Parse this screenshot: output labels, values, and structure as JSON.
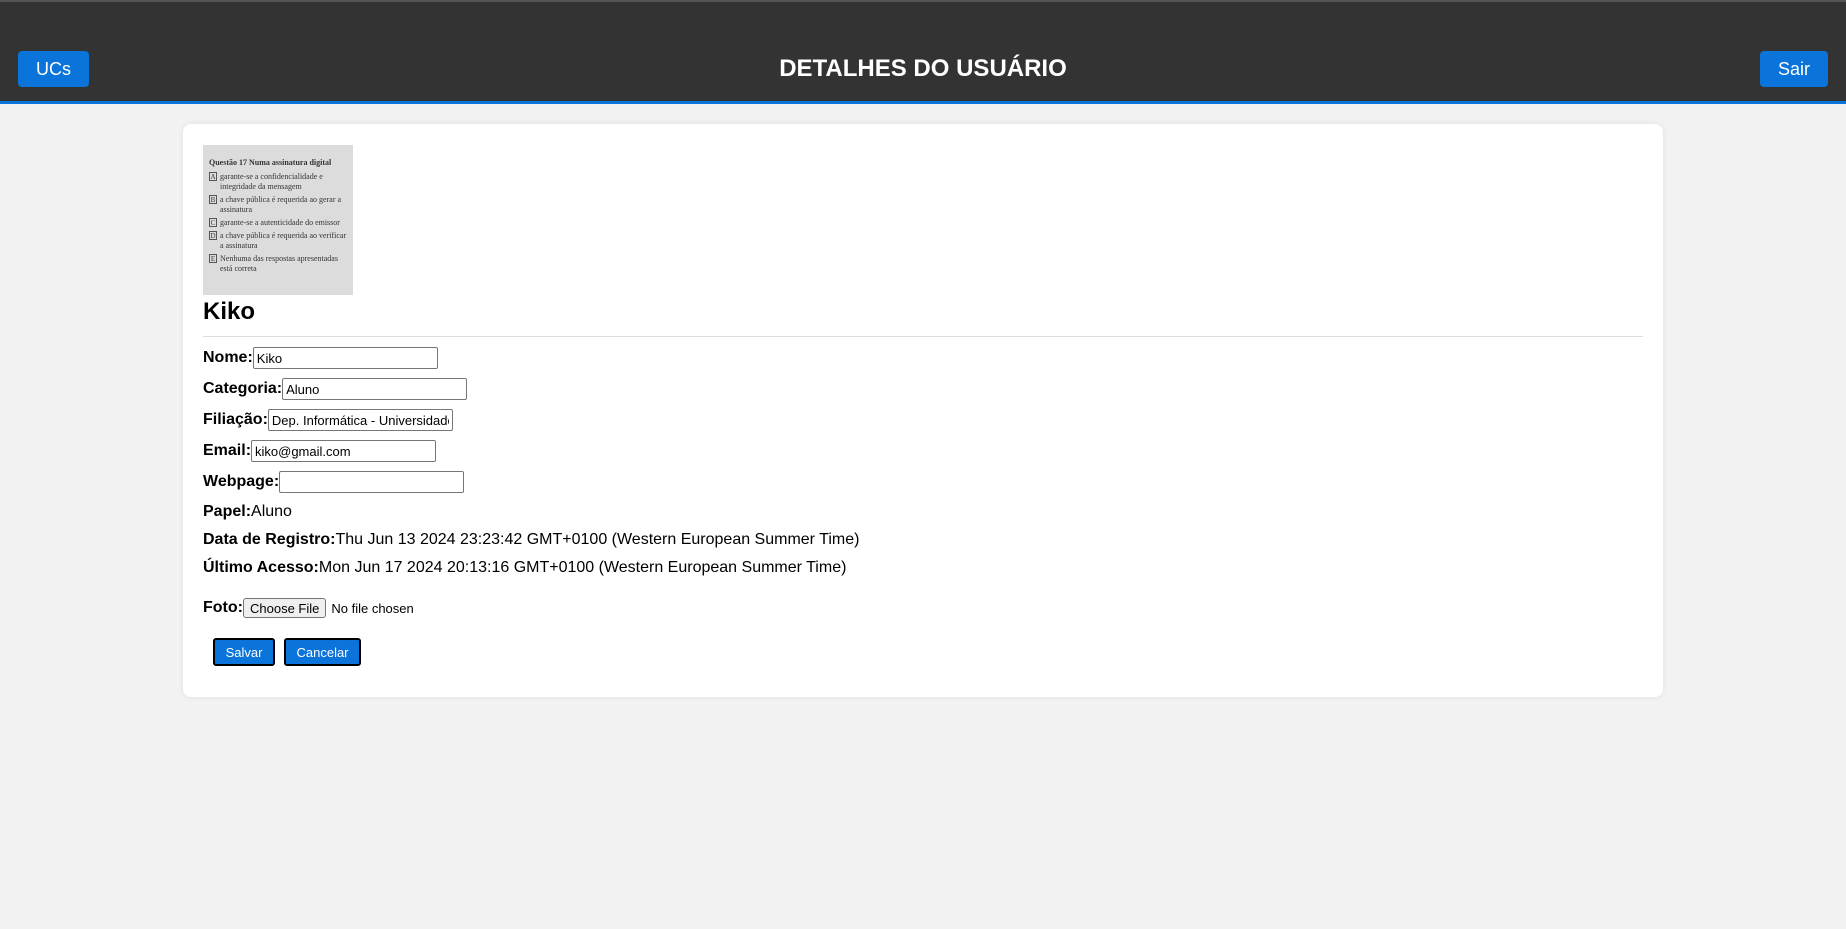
{
  "header": {
    "title": "DETALHES DO USUÁRIO",
    "ucs_label": "UCs",
    "sair_label": "Sair"
  },
  "profile": {
    "name": "Kiko",
    "photo_text": {
      "question": "Questão 17   Numa assinatura digital",
      "options": [
        {
          "letter": "A",
          "text": "garante-se a confidencialidade e integridade da mensagem"
        },
        {
          "letter": "B",
          "text": "a chave pública é requerida ao gerar a assinatura"
        },
        {
          "letter": "C",
          "text": "garante-se a autenticidade do emissor"
        },
        {
          "letter": "D",
          "text": "a chave pública é requerida ao verificar a assinatura"
        },
        {
          "letter": "E",
          "text": "Nenhuma das respostas apresentadas está correta"
        }
      ]
    }
  },
  "form": {
    "nome_label": "Nome:",
    "nome_value": "Kiko",
    "categoria_label": "Categoria:",
    "categoria_value": "Aluno",
    "filiacao_label": "Filiação:",
    "filiacao_value": "Dep. Informática - Universidade",
    "email_label": "Email:",
    "email_value": "kiko@gmail.com",
    "webpage_label": "Webpage:",
    "webpage_value": "",
    "papel_label": "Papel:",
    "papel_value": "Aluno",
    "registro_label": "Data de Registro:",
    "registro_value": "Thu Jun 13 2024 23:23:42 GMT+0100 (Western European Summer Time)",
    "acesso_label": "Último Acesso:",
    "acesso_value": "Mon Jun 17 2024 20:13:16 GMT+0100 (Western European Summer Time)",
    "foto_label": "Foto:",
    "file_button": "Choose File",
    "file_status": "No file chosen"
  },
  "actions": {
    "salvar": "Salvar",
    "cancelar": "Cancelar"
  },
  "colors": {
    "accent": "#0a74da",
    "header_bg": "#333333",
    "page_bg": "#f2f2f2"
  }
}
